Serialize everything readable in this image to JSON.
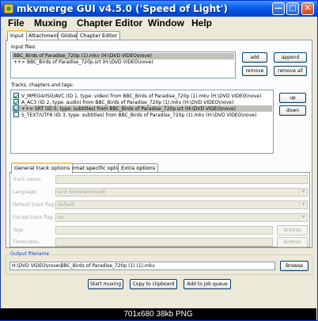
{
  "window": {
    "title": "mkvmerge GUI v4.5.0 ('Speed of Light')"
  },
  "menu": [
    "File",
    "Muxing",
    "Chapter Editor",
    "Window",
    "Help"
  ],
  "tabs": [
    "Input",
    "Attachments",
    "Global",
    "Chapter Editor"
  ],
  "input": {
    "files_label": "Input files:",
    "files": [
      "BBC_Birds of Paradise_720p (1).mkv (H:\\DVD VIDEO\\nove)",
      "++> BBC_Birds of Paradise_720p.srt (H:\\DVD VIDEO\\nove)"
    ],
    "add": "add",
    "append": "append",
    "remove": "remove",
    "remove_all": "remove all",
    "tracks_label": "Tracks, chapters and tags:",
    "tracks": [
      {
        "text": "V_MPEG4/ISO/AVC (ID 1, type: video) from BBC_Birds of Paradise_720p (1).mkv (H:\\DVD VIDEO\\nove)",
        "checked": true
      },
      {
        "text": "A_AC3 (ID 2, type: audio) from BBC_Birds of Paradise_720p (1).mkv (H:\\DVD VIDEO\\nove)",
        "checked": true
      },
      {
        "text": "++> SRT (ID 0, type: subtitles) from BBC_Birds of Paradise_720p.srt (H:\\DVD VIDEO\\nove)",
        "checked": true
      },
      {
        "text": "S_TEXT/UTF8 (ID 3, type: subtitles) from BBC_Birds of Paradise_720p (1).mkv (H:\\DVD VIDEO\\nove)",
        "checked": false
      }
    ],
    "up": "up",
    "down": "down"
  },
  "track_tabs": [
    "General track options",
    "Format specific options",
    "Extra options"
  ],
  "options": {
    "track_name": "Track name:",
    "language": "Language:",
    "language_value": "und (Undetermined)",
    "default_flag": "Default track flag:",
    "default_flag_value": "default",
    "forced_flag": "Forced track flag:",
    "forced_flag_value": "no",
    "tags": "Tags:",
    "timecodes": "Timecodes:",
    "browse": "Browse"
  },
  "output": {
    "group_label": "Output filename",
    "filename": "H:\\DVD VIDEO\\nove\\BBC_Birds of Paradise_720p (1) (1).mkv",
    "browse": "Browse"
  },
  "actions": {
    "start": "Start muxing",
    "copy": "Copy to clipboard",
    "queue": "Add to job queue"
  },
  "caption": "701x680 38kb PNG"
}
